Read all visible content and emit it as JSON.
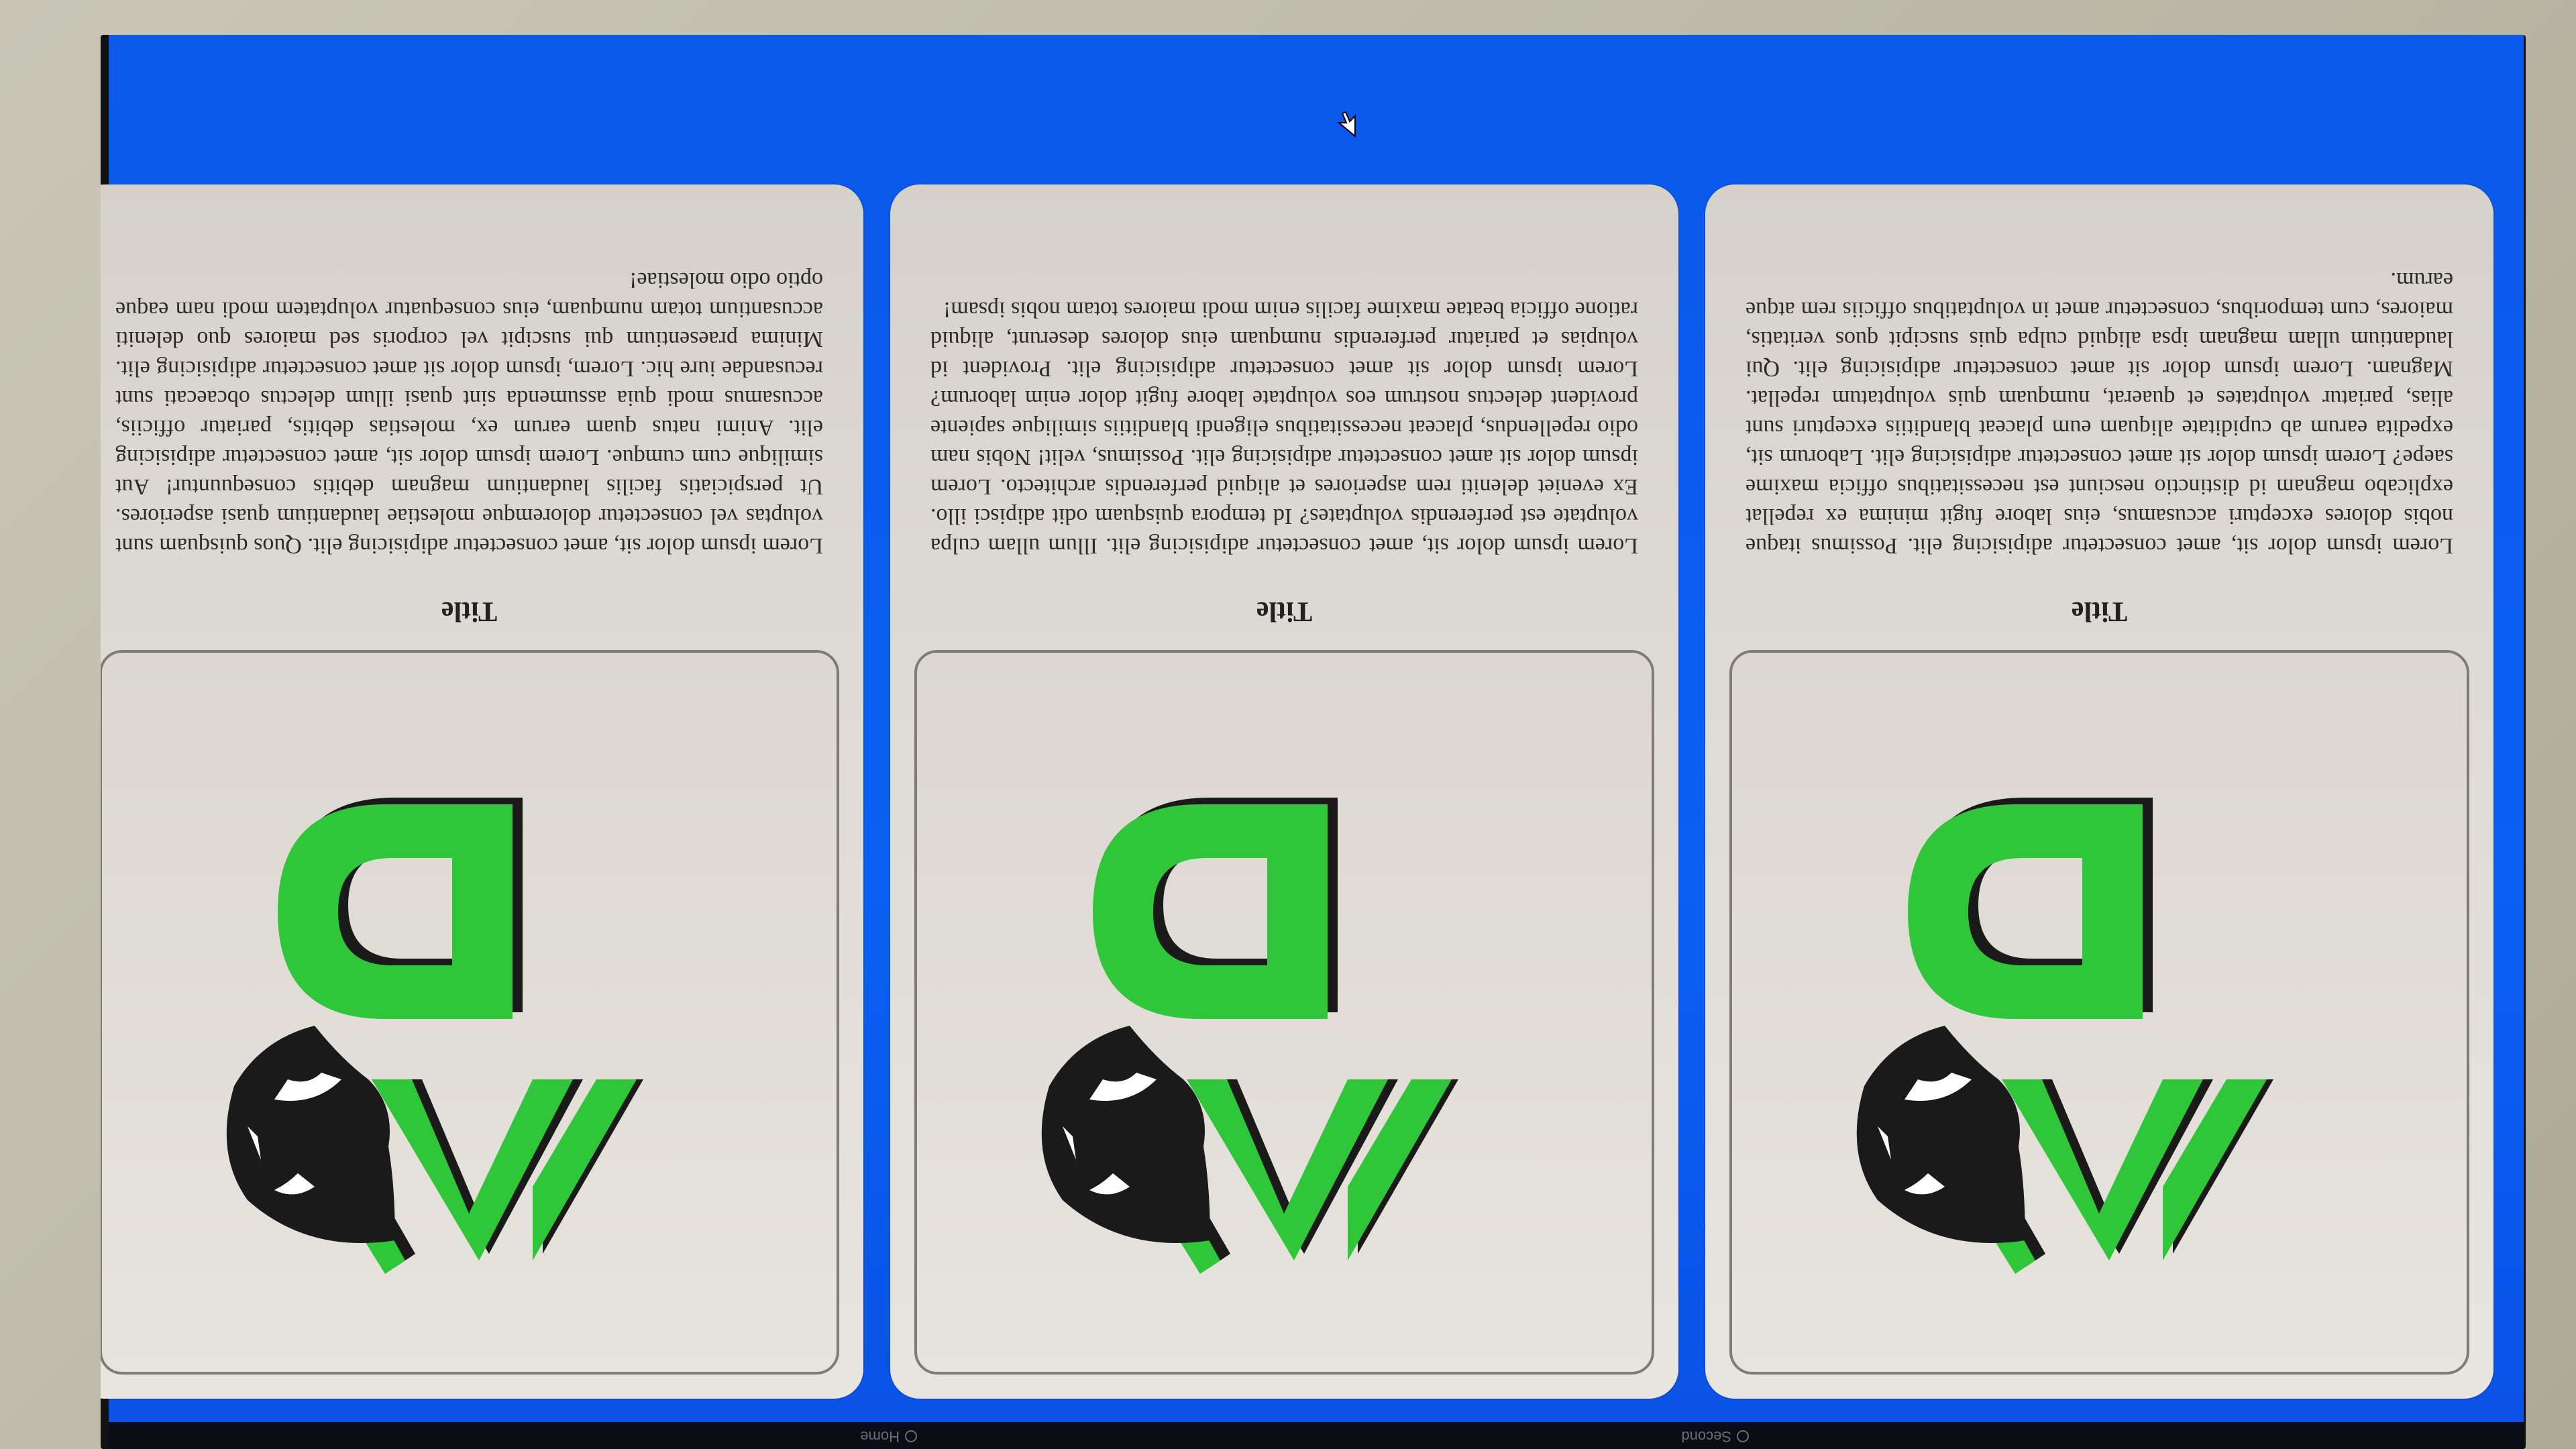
{
  "taskbar": {
    "tabs": [
      {
        "label": "Second"
      },
      {
        "label": "Home"
      }
    ]
  },
  "cards": [
    {
      "title": "Title",
      "body": "Lorem ipsum dolor sit, amet consectetur adipisicing elit. Possimus itaque nobis dolores excepturi accusamus, eius labore fugit minima ex repellat explicabo magnam id distinctio nesciunt est necessitatibus officia maxime saepe? Lorem ipsum dolor sit amet consectetur adipisicing elit. Laborum sit, expedita earum ab cupiditate aliquam eum placeat blanditiis excepturi sunt alias, pariatur voluptates et quaerat, numquam quis voluptatum repellat. Magnam. Lorem ipsum dolor sit amet consectetur adipisicing elit. Qui laudantium ullam magnam ipsa aliquid culpa quis suscipit quos veritatis, maiores, cum temporibus, consectetur amet in voluptatibus officiis rem atque earum."
    },
    {
      "title": "Title",
      "body": "Lorem ipsum dolor sit, amet consectetur adipisicing elit. Illum ullam culpa voluptate est perferendis voluptates? Id tempora quisquam odit adipisci illo. Ex eveniet deleniti rem asperiores et aliquid perferendis architecto. Lorem ipsum dolor sit amet consectetur adipisicing elit. Possimus, velit! Nobis nam odio repellendus, placeat necessitatibus eligendi blanditiis similique sapiente provident delectus nostrum eos voluptate labore fugit dolor enim laborum? Lorem ipsum dolor sit amet consectetur adipisicing elit. Provident id volupias et pariatur perferendis numquam eius dolores deserunt, aliquid ratione officia beatae maxime facilis enim modi maiores totam nobis ipsam!"
    },
    {
      "title": "Title",
      "body": "Lorem ipsum dolor sit, amet consectetur adipisicing elit. Quos quisquam sunt voluptas vel consectetur doloremque molestiae laudantium quasi asperiores. Ut perspiciatis facilis laudantium magnam debitis consequuntur! Aut similique cum cumque. Lorem ipsum dolor sit, amet consectetur adipisicing elit. Animi natus quam earum ex, molestias debitis, pariatur officiis, accusamus modi quia assumenda sint quasi illum delectus obcaecati sunt recusandae iure hic. Lorem, ipsum dolor sit amet consectetur adipisicing elit. Minima praesentium qui suscipit vel corporis sed maiores quo deleniti accusantium totam numquam, eius consequatur voluptatem modi nam eaque optio odio molestiae!"
    }
  ],
  "colors": {
    "screen_bg": "#0a5cf0",
    "card_bg": "#e4e0da",
    "logo_green": "#2fc63a",
    "logo_dark": "#1a1a1a"
  },
  "icons": {
    "logo": "wd-panther-logo",
    "cursor": "mouse-pointer-icon"
  }
}
